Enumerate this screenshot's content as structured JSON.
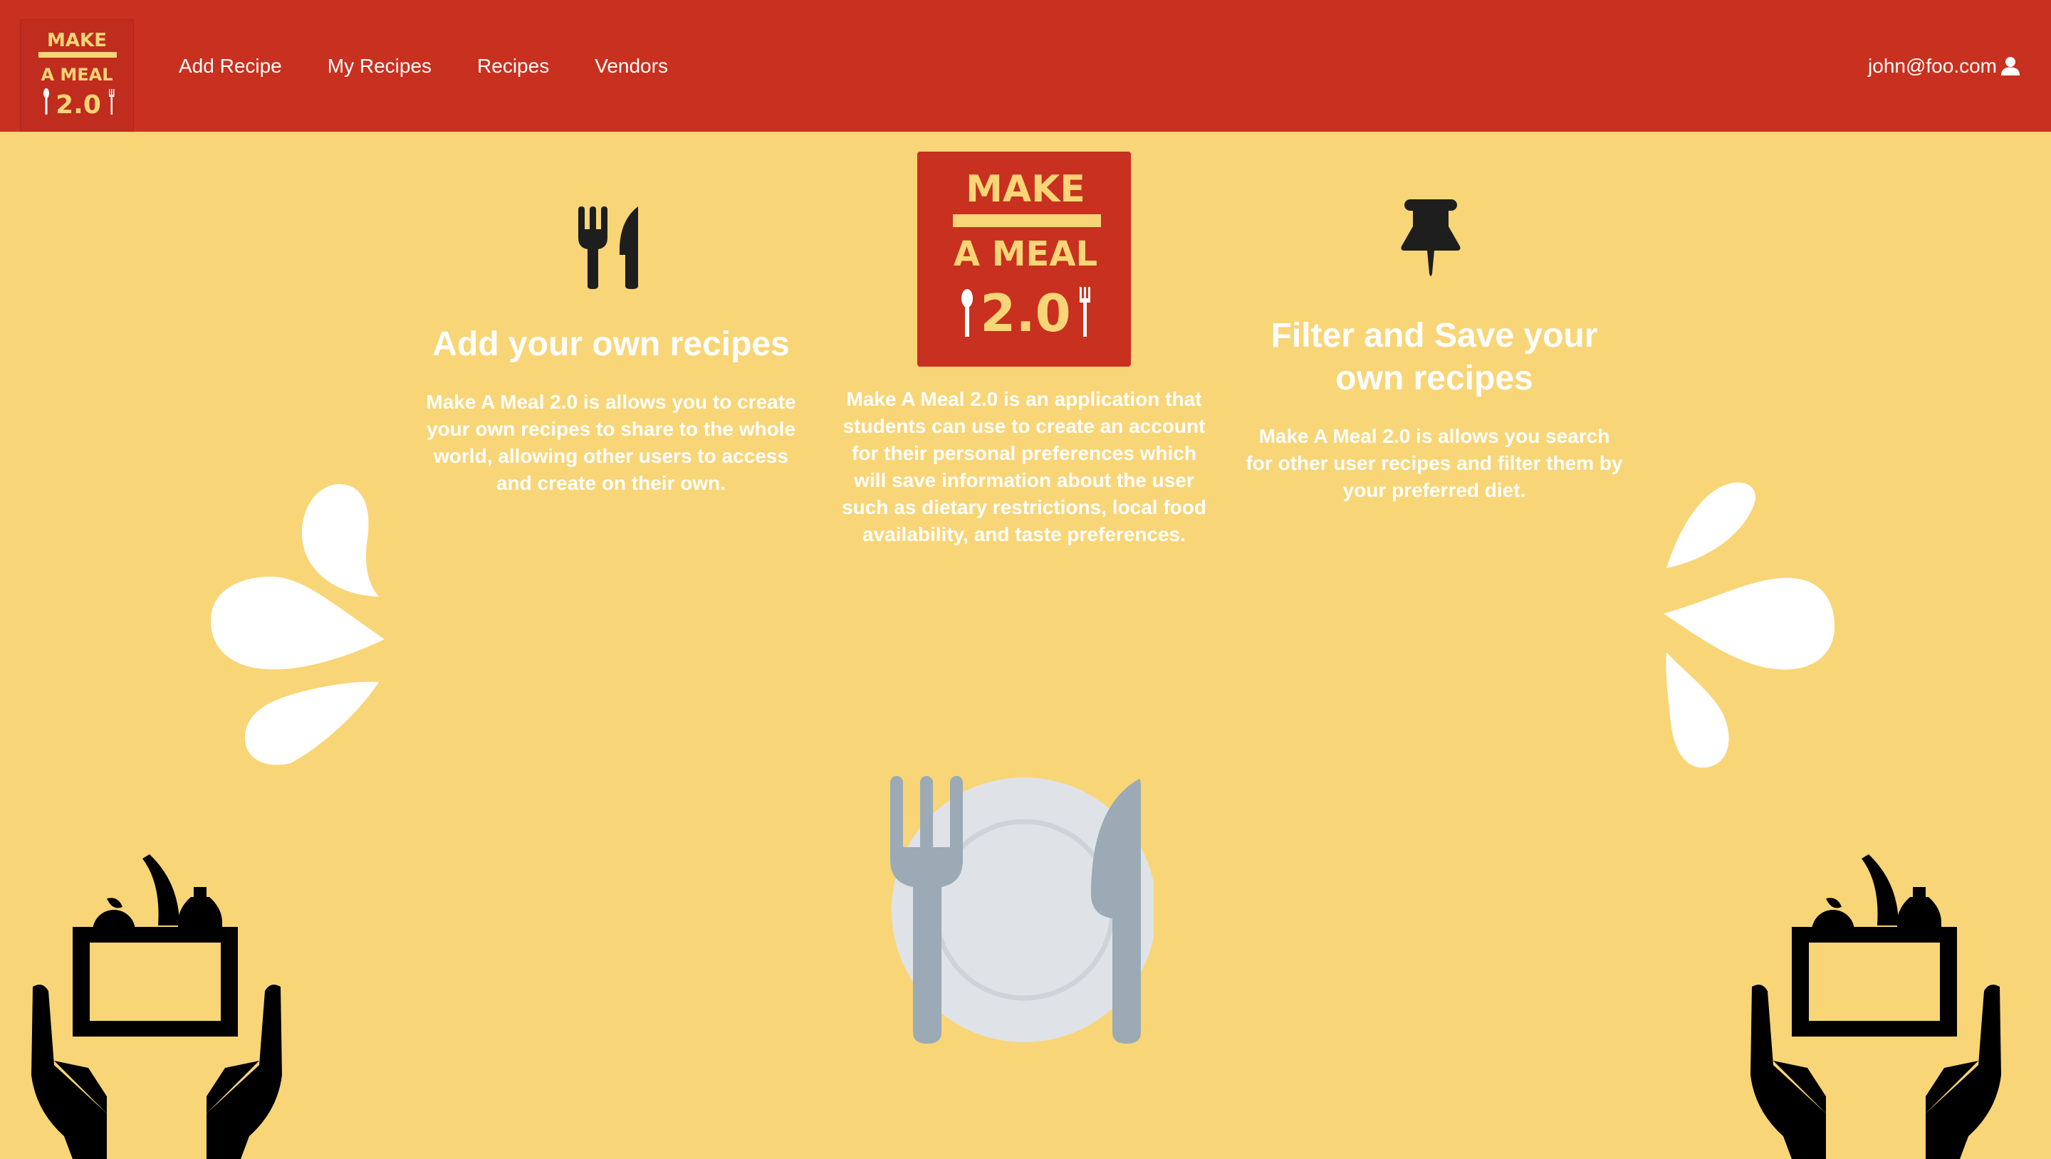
{
  "nav": {
    "links": [
      {
        "label": "Add Recipe"
      },
      {
        "label": "My Recipes"
      },
      {
        "label": "Recipes"
      },
      {
        "label": "Vendors"
      }
    ],
    "user_email": "john@foo.com",
    "user_icon": "user-icon"
  },
  "logo": {
    "line1": "MAKE",
    "line2": "A MEAL",
    "line3": "2.0"
  },
  "features": [
    {
      "icon": "utensils-icon",
      "title": "Add your own recipes",
      "body": "Make A Meal 2.0 is allows you to create your own recipes to share to the whole world, allowing other users to access and create on their own."
    },
    {
      "icon": "make-a-meal-logo",
      "title": "",
      "body": "Make A Meal 2.0 is an application that students can use to create an account for their personal preferences which will save information about the user such as dietary restrictions, local food availability, and taste preferences."
    },
    {
      "icon": "pushpin-icon",
      "title": "Filter and Save your own recipes",
      "body": "Make A Meal 2.0 is allows you search for other user recipes and filter them by your preferred diet."
    }
  ],
  "colors": {
    "navbar": "#C8301F",
    "background": "#F8D577",
    "text": "#FFFFFF",
    "icon": "#1E1E1E",
    "plate": "#DFE3E8",
    "cutlery": "#9BAAB5"
  }
}
